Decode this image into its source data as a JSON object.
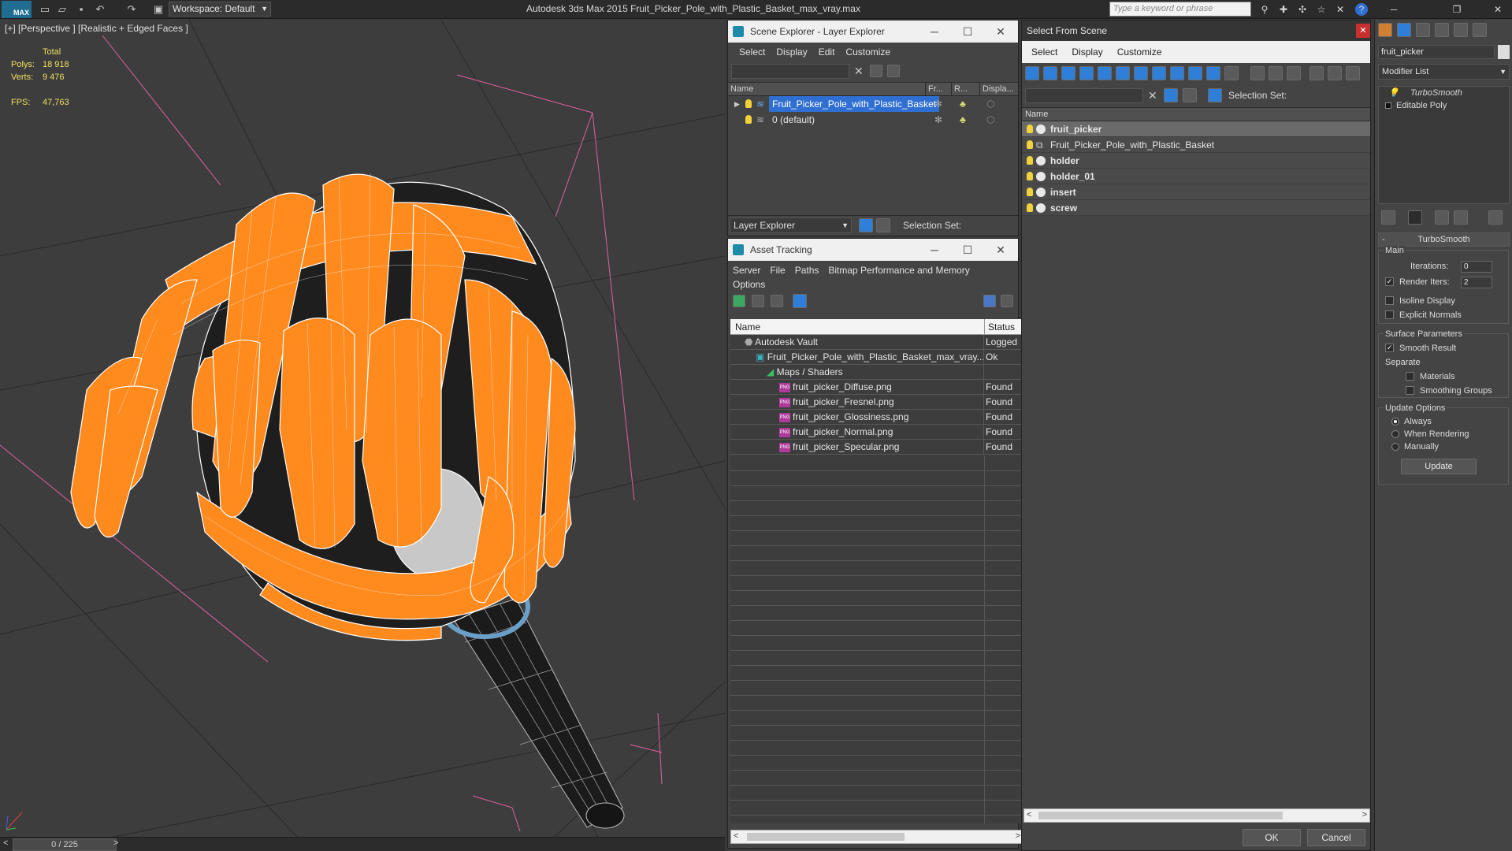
{
  "app": {
    "title": "Autodesk 3ds Max  2015     Fruit_Picker_Pole_with_Plastic_Basket_max_vray.max",
    "logo": "MAX",
    "workspace": "Workspace: Default",
    "search_placeholder": "Type a keyword or phrase"
  },
  "viewport": {
    "label": "[+] [Perspective ] [Realistic + Edged Faces ]",
    "stats": {
      "total_label": "Total",
      "polys_label": "Polys:",
      "polys": "18 918",
      "verts_label": "Verts:",
      "verts": "9 476",
      "fps_label": "FPS:",
      "fps": "47,763"
    },
    "frame": "0 / 225",
    "colors": {
      "basket": "#ff8a1e",
      "pole": "#1b1b1b",
      "ring": "#6aa0c8",
      "guide": "#e060a0"
    }
  },
  "scene_explorer": {
    "title": "Scene Explorer - Layer Explorer",
    "menu": [
      "Select",
      "Display",
      "Edit",
      "Customize"
    ],
    "columns": [
      "Name",
      "Fr...",
      "R...",
      "Displa..."
    ],
    "rows": [
      {
        "name": "Fruit_Picker_Pole_with_Plastic_Basket",
        "selected": true
      },
      {
        "name": "0 (default)",
        "selected": false
      }
    ],
    "bottom_dropdown": "Layer Explorer",
    "selection_set_label": "Selection Set:"
  },
  "asset_tracking": {
    "title": "Asset Tracking",
    "menu": [
      "Server",
      "File",
      "Paths",
      "Bitmap Performance and Memory"
    ],
    "menu2": "Options",
    "columns": [
      "Name",
      "Status"
    ],
    "rows": [
      {
        "name": "Autodesk Vault",
        "status": "Logged"
      },
      {
        "name": "Fruit_Picker_Pole_with_Plastic_Basket_max_vray...",
        "status": "Ok"
      },
      {
        "name": "Maps / Shaders",
        "status": ""
      },
      {
        "name": "fruit_picker_Diffuse.png",
        "status": "Found"
      },
      {
        "name": "fruit_picker_Fresnel.png",
        "status": "Found"
      },
      {
        "name": "fruit_picker_Glossiness.png",
        "status": "Found"
      },
      {
        "name": "fruit_picker_Normal.png",
        "status": "Found"
      },
      {
        "name": "fruit_picker_Specular.png",
        "status": "Found"
      }
    ]
  },
  "select_from_scene": {
    "title": "Select From Scene",
    "menu": [
      "Select",
      "Display",
      "Customize"
    ],
    "selection_set_label": "Selection Set:",
    "column": "Name",
    "items": [
      {
        "name": "fruit_picker",
        "bold": true,
        "selected": true
      },
      {
        "name": "Fruit_Picker_Pole_with_Plastic_Basket",
        "bold": false,
        "selected": false
      },
      {
        "name": "holder",
        "bold": true,
        "selected": false
      },
      {
        "name": "holder_01",
        "bold": true,
        "selected": false
      },
      {
        "name": "insert",
        "bold": true,
        "selected": false
      },
      {
        "name": "screw",
        "bold": true,
        "selected": false
      }
    ],
    "ok": "OK",
    "cancel": "Cancel"
  },
  "command_panel": {
    "object_name": "fruit_picker",
    "modifier_list": "Modifier List",
    "stack": [
      "TurboSmooth",
      "Editable Poly"
    ],
    "rollout_title": "TurboSmooth",
    "main_label": "Main",
    "iterations_label": "Iterations:",
    "iterations": "0",
    "render_iters_label": "Render Iters:",
    "render_iters": "2",
    "isoline": "Isoline Display",
    "explicit": "Explicit Normals",
    "surface_label": "Surface Parameters",
    "smooth_result": "Smooth Result",
    "separate_label": "Separate",
    "materials": "Materials",
    "smoothing_groups": "Smoothing Groups",
    "update_label": "Update Options",
    "always": "Always",
    "when_rendering": "When Rendering",
    "manually": "Manually",
    "update_btn": "Update"
  }
}
